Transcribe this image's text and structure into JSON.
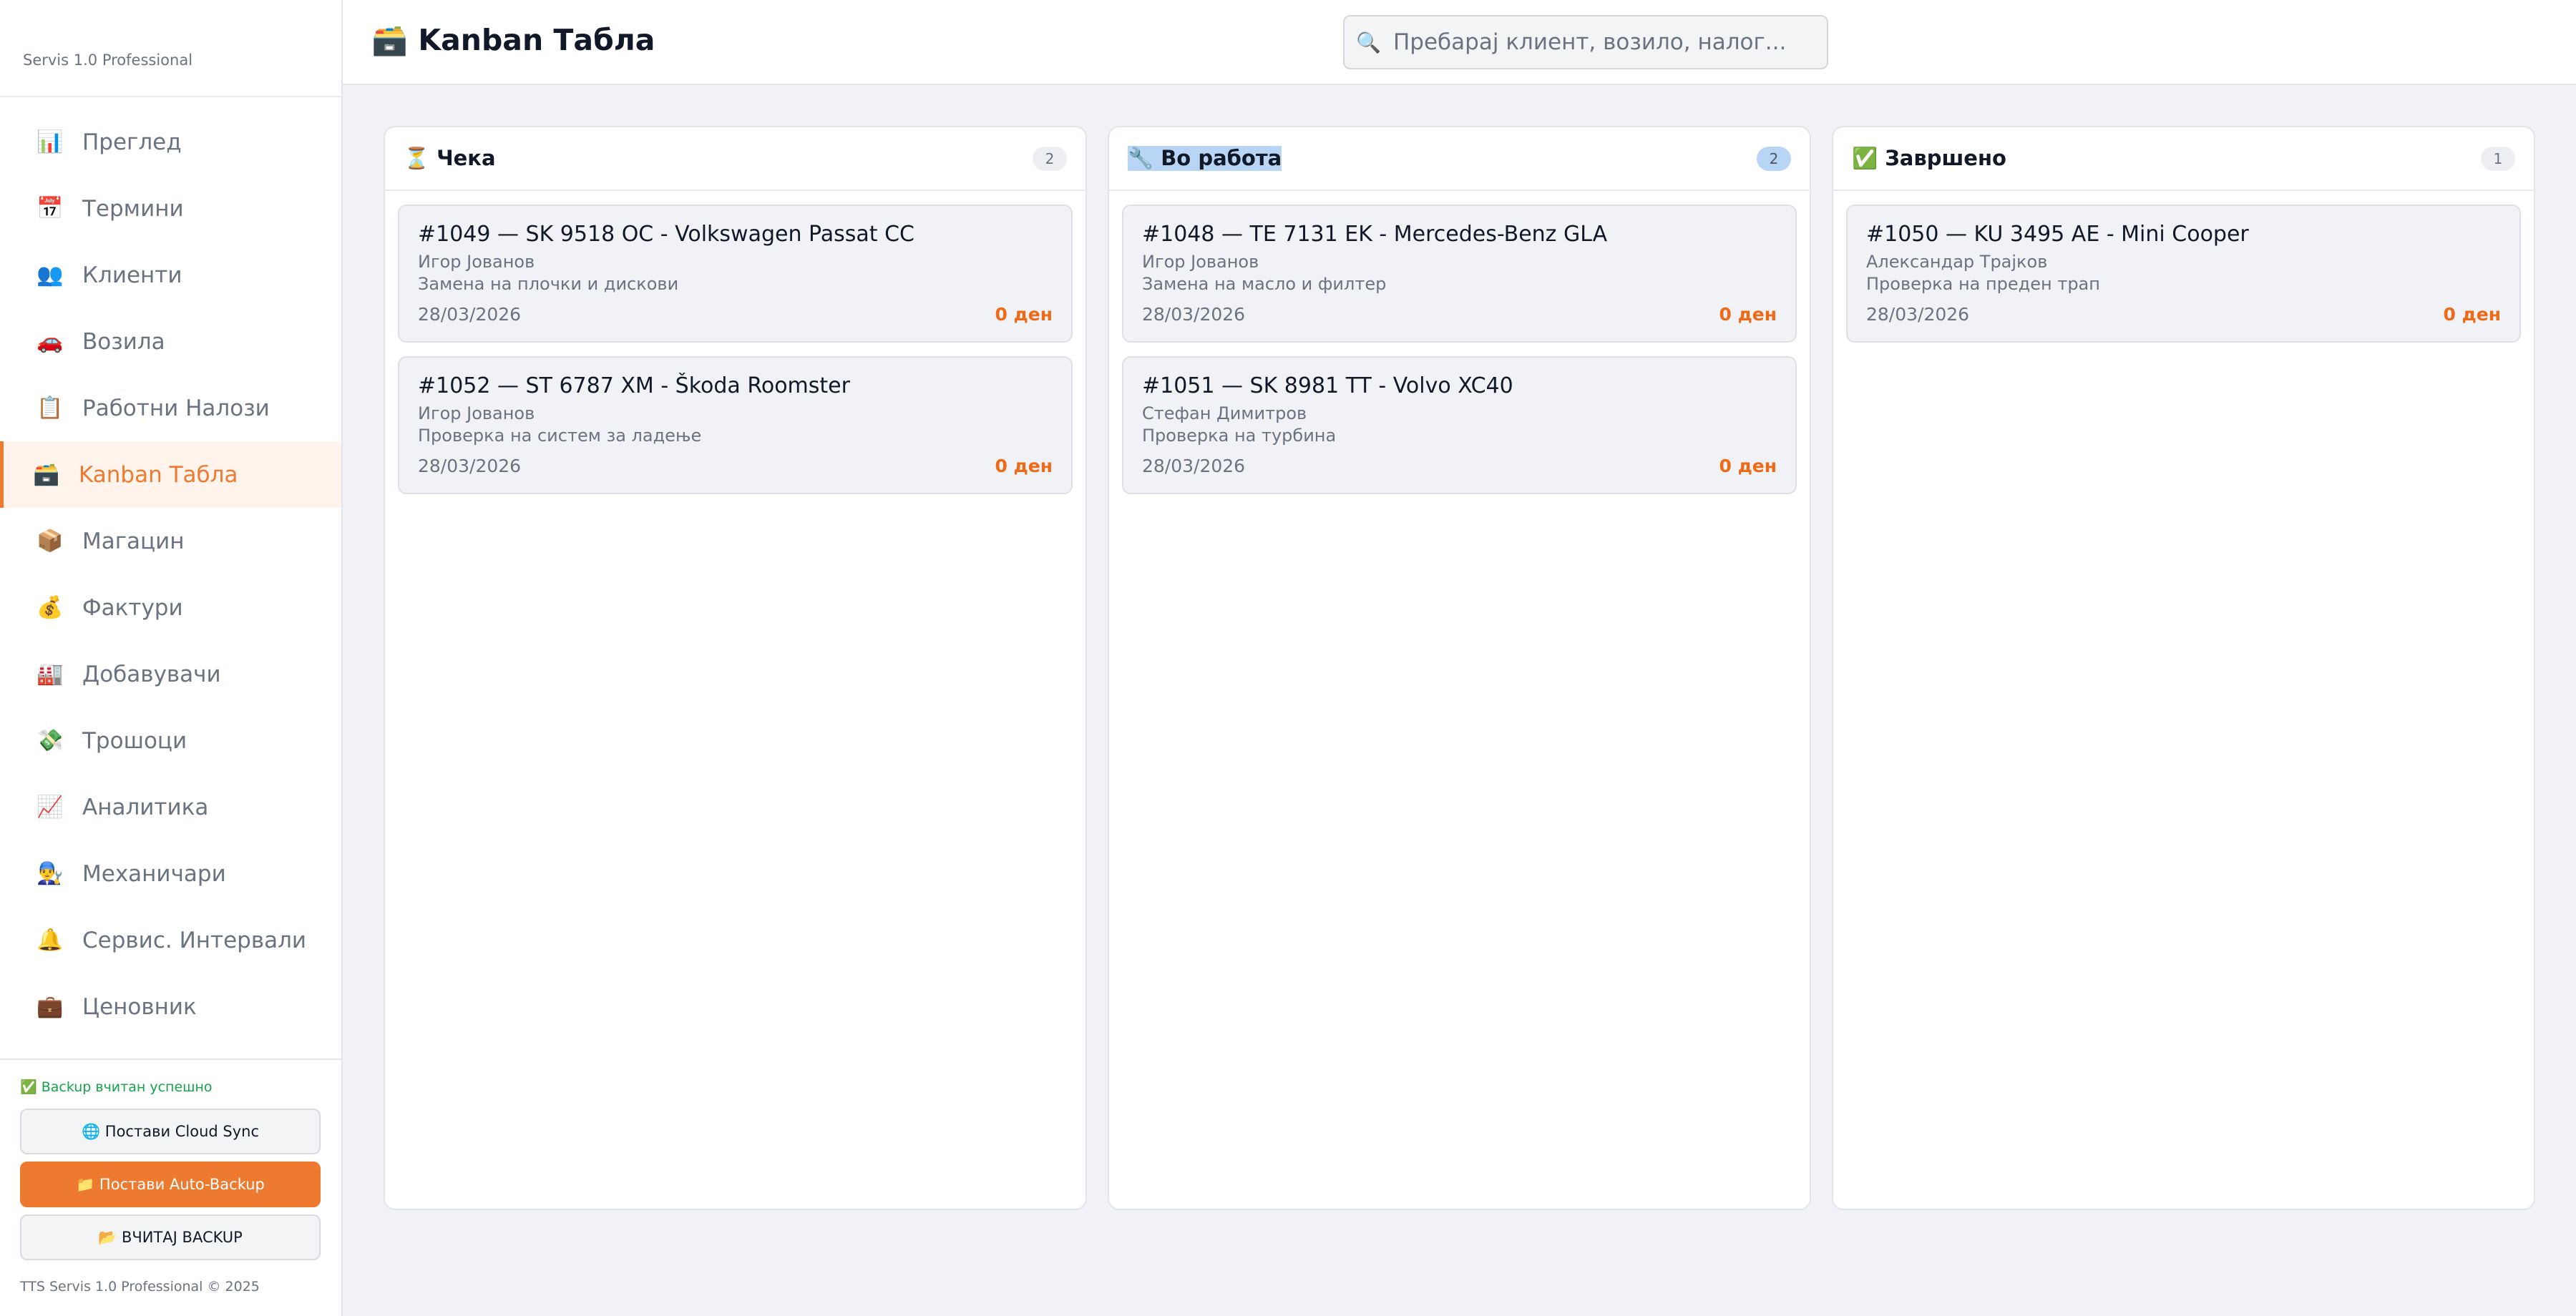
{
  "app": {
    "brand": "Servis 1.0 Professional"
  },
  "sidebar": {
    "items": [
      {
        "icon": "📊",
        "label": "Преглед"
      },
      {
        "icon": "📅",
        "label": "Термини"
      },
      {
        "icon": "👥",
        "label": "Клиенти"
      },
      {
        "icon": "🚗",
        "label": "Возила"
      },
      {
        "icon": "📋",
        "label": "Работни Налози"
      },
      {
        "icon": "🗃️",
        "label": "Kanban Табла"
      },
      {
        "icon": "📦",
        "label": "Магацин"
      },
      {
        "icon": "💰",
        "label": "Фактури"
      },
      {
        "icon": "🏭",
        "label": "Добавувачи"
      },
      {
        "icon": "💸",
        "label": "Трошоци"
      },
      {
        "icon": "📈",
        "label": "Аналитика"
      },
      {
        "icon": "👨‍🔧",
        "label": "Механичари"
      },
      {
        "icon": "🔔",
        "label": "Сервис. Интервали"
      },
      {
        "icon": "💼",
        "label": "Ценовник"
      }
    ],
    "active_index": 5,
    "backup_status": "✅ Backup вчитан успешно",
    "cloud_sync_label": "🌐 Постави Cloud Sync",
    "auto_backup_label": "📁 Постави Auto-Backup",
    "load_backup_label": "📂 ВЧИТАЈ BACKUP",
    "copyright": "TTS Servis 1.0 Professional © 2025"
  },
  "header": {
    "title": "🗃️ Kanban Табла",
    "search_placeholder": "Пребарај клиент, возило, налог...",
    "search_icon": "🔍"
  },
  "columns": [
    {
      "title": "⏳ Чека",
      "count": "2",
      "cards": [
        {
          "title": "#1049 — SK 9518 OC - Volkswagen Passat CC",
          "client": "Игор Јованов",
          "desc": "Замена на плочки и дискови",
          "date": "28/03/2026",
          "amount": "0 ден"
        },
        {
          "title": "#1052 — ST 6787 XM - Škoda Roomster",
          "client": "Игор Јованов",
          "desc": "Проверка на систем за ладење",
          "date": "28/03/2026",
          "amount": "0 ден"
        }
      ]
    },
    {
      "title": "🔧 Во работа",
      "count": "2",
      "cards": [
        {
          "title": "#1048 — TE 7131 EK - Mercedes-Benz GLA",
          "client": "Игор Јованов",
          "desc": "Замена на масло и филтер",
          "date": "28/03/2026",
          "amount": "0 ден"
        },
        {
          "title": "#1051 — SK 8981 TT - Volvo XC40",
          "client": "Стефан Димитров",
          "desc": "Проверка на турбина",
          "date": "28/03/2026",
          "amount": "0 ден"
        }
      ]
    },
    {
      "title": "✅ Завршено",
      "count": "1",
      "cards": [
        {
          "title": "#1050 — KU 3495 AE - Mini Cooper",
          "client": "Александар Трајков",
          "desc": "Проверка на преден трап",
          "date": "28/03/2026",
          "amount": "0 ден"
        }
      ]
    }
  ]
}
